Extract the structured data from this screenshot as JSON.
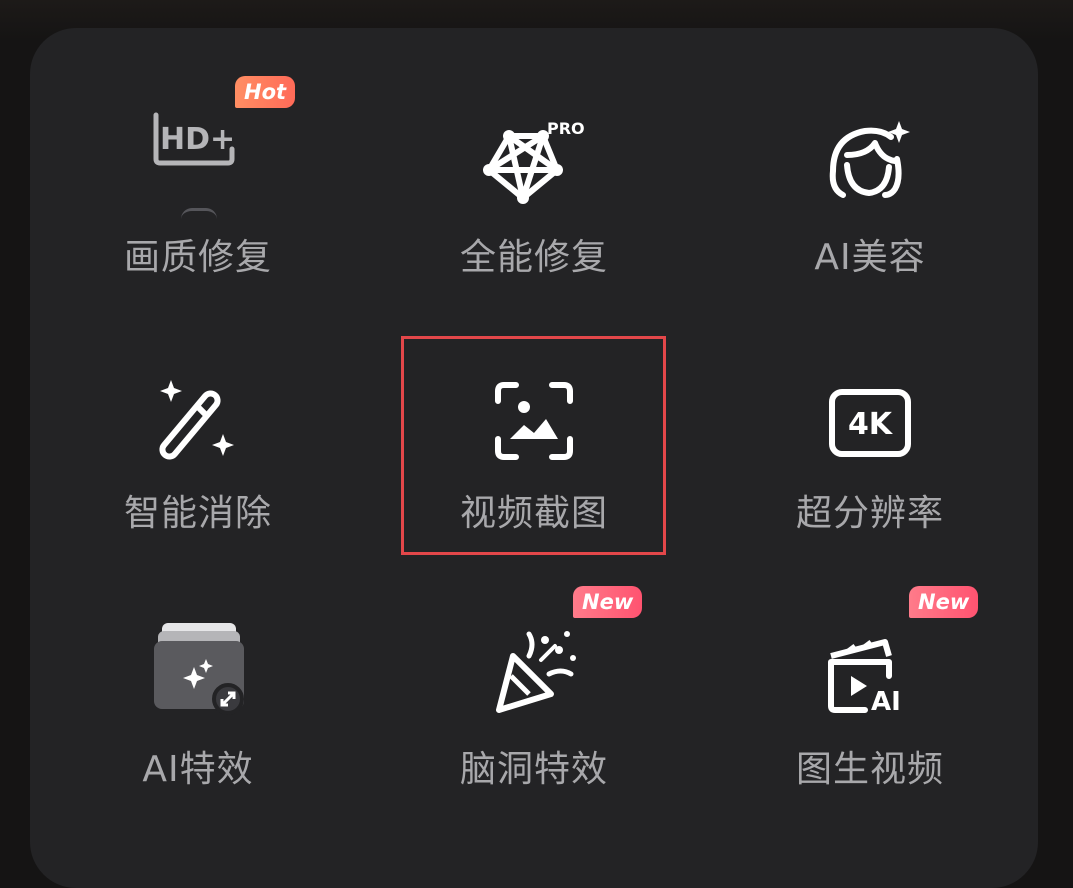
{
  "grid": {
    "items": [
      {
        "id": "hd",
        "label": "画质修复",
        "icon": "hd-plus-icon",
        "icon_text": "HD+",
        "badge": "Hot"
      },
      {
        "id": "pro",
        "label": "全能修复",
        "icon": "pro-mesh-icon",
        "icon_text": "PRO"
      },
      {
        "id": "beauty",
        "label": "AI美容",
        "icon": "face-sparkle-icon"
      },
      {
        "id": "erase",
        "label": "智能消除",
        "icon": "magic-wand-icon"
      },
      {
        "id": "capture",
        "label": "视频截图",
        "icon": "image-scan-icon"
      },
      {
        "id": "sr",
        "label": "超分辨率",
        "icon": "4k-icon",
        "icon_text": "4K"
      },
      {
        "id": "aifx",
        "label": "AI特效",
        "icon": "stacked-cards-sparkle-icon"
      },
      {
        "id": "brainfx",
        "label": "脑洞特效",
        "icon": "party-popper-icon",
        "badge": "New"
      },
      {
        "id": "img2vid",
        "label": "图生视频",
        "icon": "clapper-ai-icon",
        "icon_text": "AI",
        "badge": "New"
      }
    ]
  },
  "colors": {
    "background": "#151414",
    "panel": "#232325",
    "label": "#a8a8ab",
    "highlight_border": "#e3474a",
    "hot_badge": "#ff7a5c",
    "new_badge": "#ff5f7a"
  },
  "highlighted_item": "视频截图"
}
